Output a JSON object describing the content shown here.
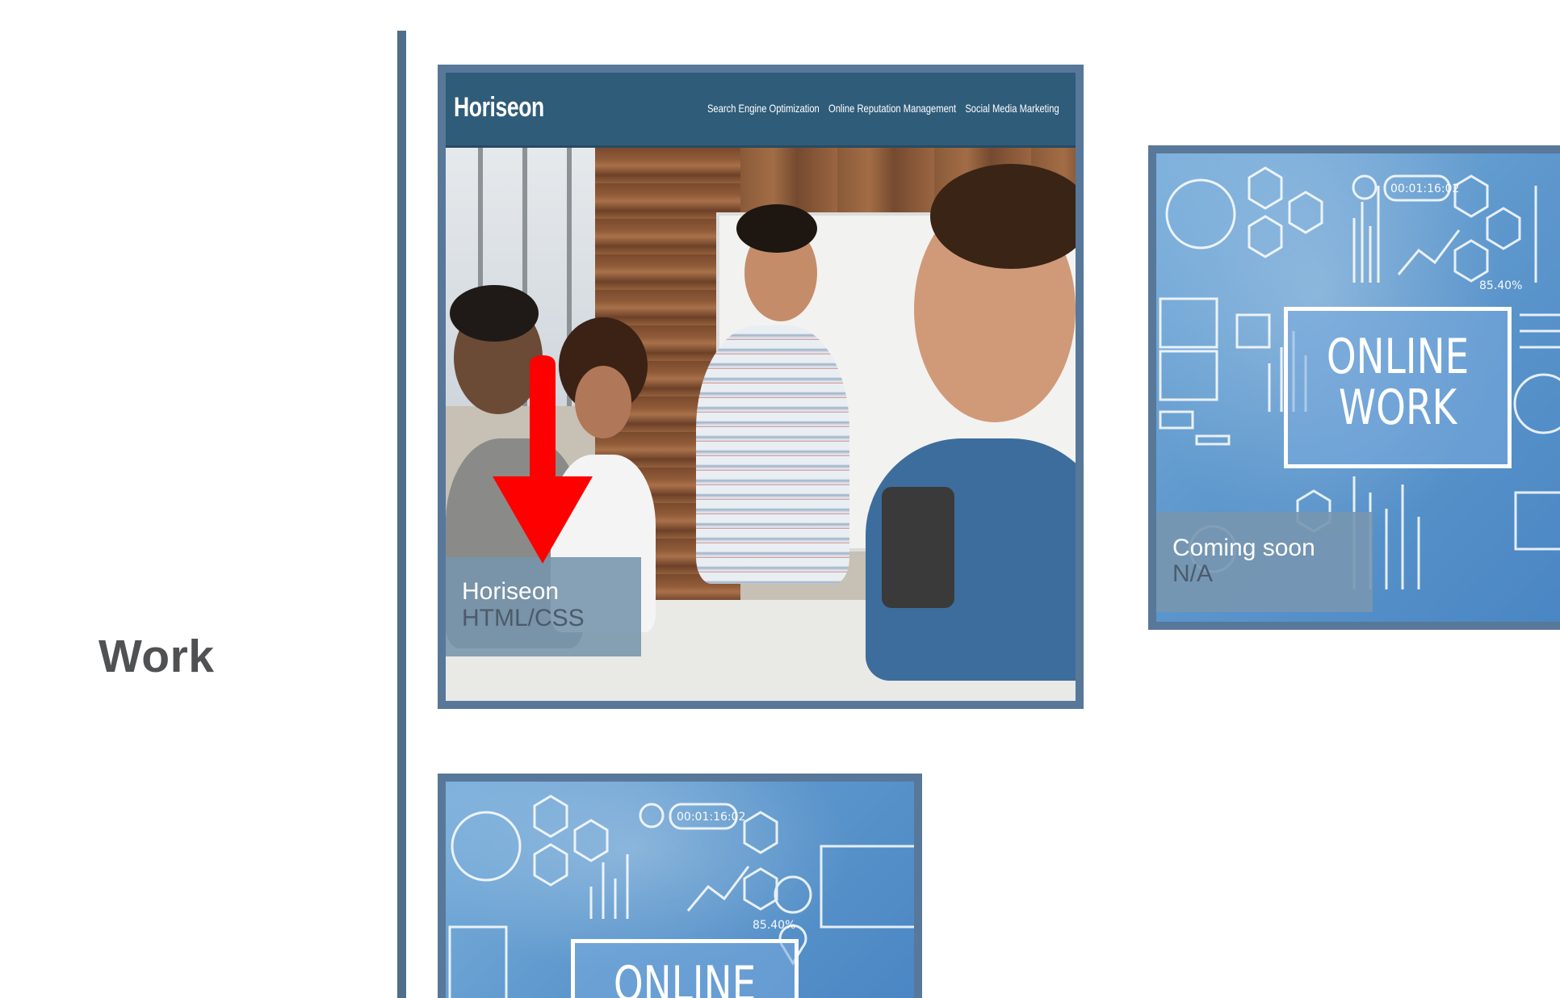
{
  "section": {
    "title": "Work"
  },
  "projects": [
    {
      "title": "Horiseon",
      "subtitle": "HTML/CSS",
      "screenshot": {
        "logo": "Horiseon",
        "nav": [
          "Search Engine Optimization",
          "Online Reputation Management",
          "Social Media Marketing"
        ]
      },
      "annotation_icon": "red-down-arrow"
    },
    {
      "title": "Coming soon",
      "subtitle": "N/A",
      "image_text": [
        "ONLINE",
        "WORK"
      ],
      "image_labels": [
        "00:01:16:02",
        "85.40%"
      ]
    },
    {
      "image_text": [
        "ONLINE"
      ],
      "image_labels": [
        "00:01:16:02",
        "85.40%"
      ]
    }
  ],
  "colors": {
    "divider": "#4e6e8c",
    "card_border": "#58789a",
    "heading": "#4f5153",
    "overlay": "#7694ac",
    "arrow": "#ff0000"
  }
}
